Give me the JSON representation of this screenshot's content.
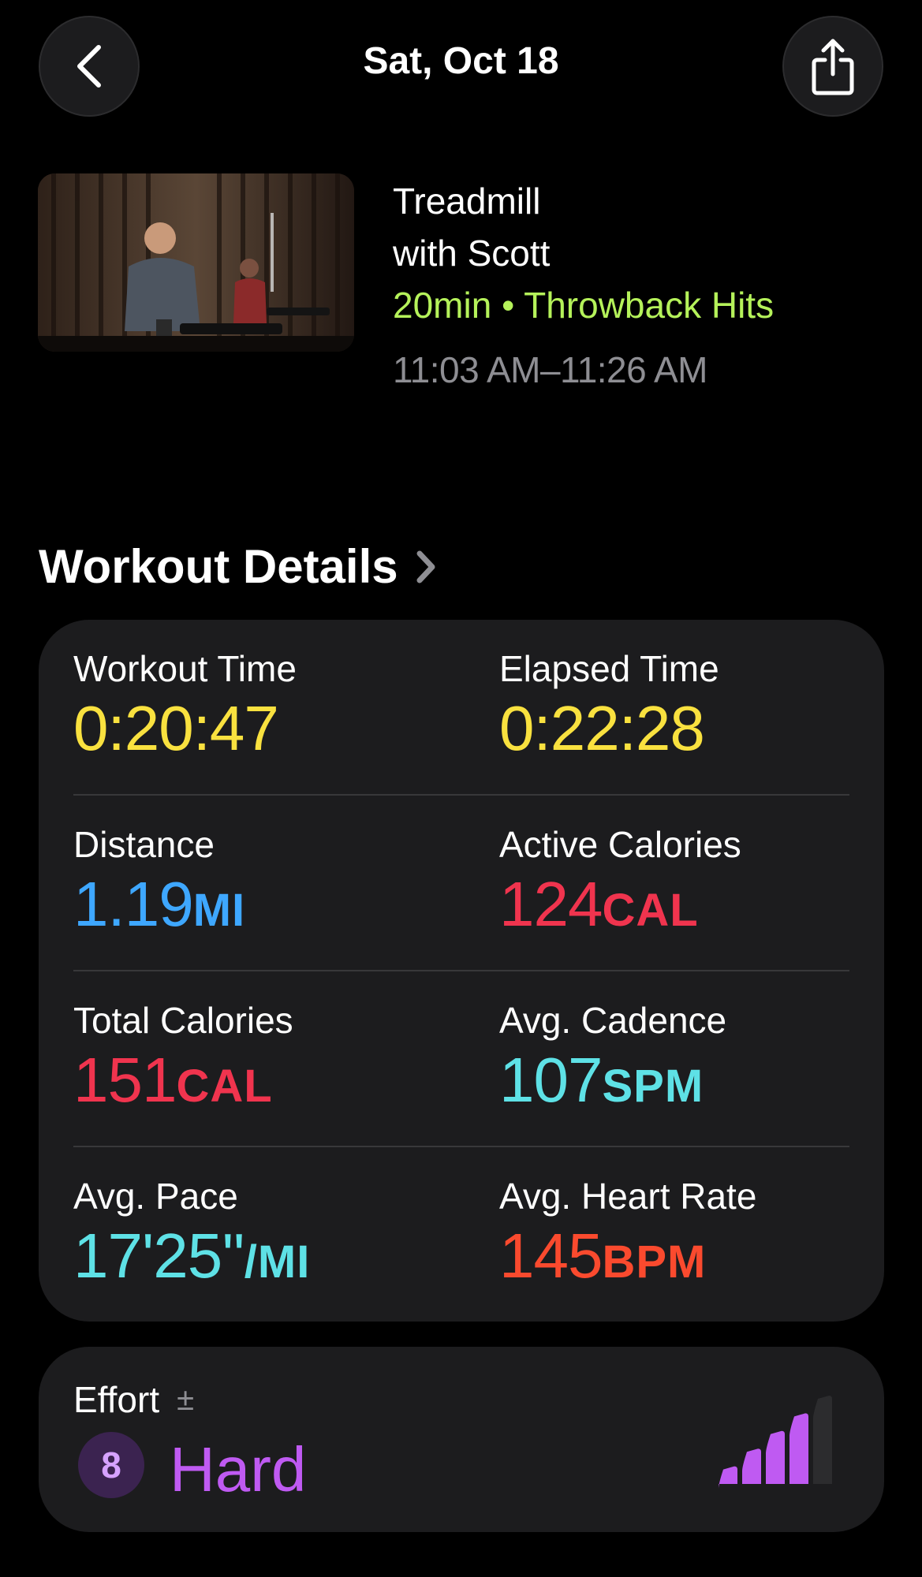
{
  "header": {
    "title": "Sat, Oct 18",
    "back_icon": "chevron-left-icon",
    "share_icon": "share-icon"
  },
  "workout": {
    "title_line1": "Treadmill",
    "title_line2": "with Scott",
    "meta": "20min • Throwback Hits",
    "time_range": "11:03 AM–11:26 AM",
    "meta_color": "#b5f25a"
  },
  "details": {
    "heading": "Workout Details",
    "metrics": [
      {
        "label": "Workout Time",
        "value": "0:20:47",
        "unit": "",
        "color": "#f9e13f"
      },
      {
        "label": "Elapsed Time",
        "value": "0:22:28",
        "unit": "",
        "color": "#f9e13f"
      },
      {
        "label": "Distance",
        "value": "1.19",
        "unit": "MI",
        "color": "#3ea7ff"
      },
      {
        "label": "Active Calories",
        "value": "124",
        "unit": "CAL",
        "color": "#f0344e"
      },
      {
        "label": "Total Calories",
        "value": "151",
        "unit": "CAL",
        "color": "#f0344e"
      },
      {
        "label": "Avg. Cadence",
        "value": "107",
        "unit": "SPM",
        "color": "#5ee1e6"
      },
      {
        "label": "Avg. Pace",
        "value": "17'25''",
        "unit": "/MI",
        "color": "#5ee1e6"
      },
      {
        "label": "Avg. Heart Rate",
        "value": "145",
        "unit": "BPM",
        "color": "#fa4a2e"
      }
    ]
  },
  "effort": {
    "label": "Effort",
    "adjust_symbol": "±",
    "score": "8",
    "level": "Hard",
    "bars_filled": 4,
    "bars_total": 5,
    "color": "#bf5af2"
  }
}
